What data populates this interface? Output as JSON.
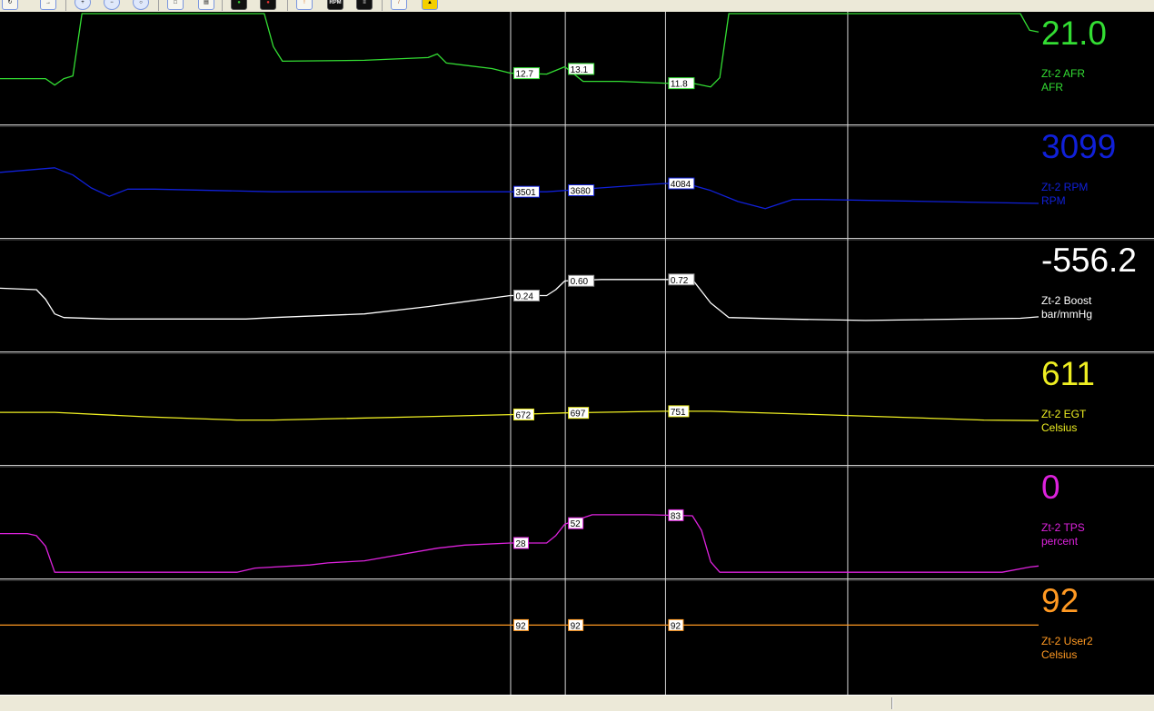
{
  "colors": {
    "background": "#000000",
    "separator": "#c8c8c8",
    "cursor": "#d8d8d8",
    "toolbar": "#ece9d8"
  },
  "toolbar": {
    "buttons": [
      {
        "icon": "refresh-icon"
      },
      {
        "icon": "arrow-icon"
      },
      {
        "icon": "zoom-in-icon"
      },
      {
        "icon": "zoom-out-icon"
      },
      {
        "icon": "zoom-reset-icon"
      },
      {
        "icon": "document-icon"
      },
      {
        "icon": "print-icon"
      },
      {
        "icon": "record-icon"
      },
      {
        "icon": "stop-record-icon"
      },
      {
        "icon": "alert-icon"
      },
      {
        "icon": "rpm-icon",
        "label": "RPM"
      },
      {
        "icon": "gauge-icon"
      },
      {
        "icon": "wrench-icon"
      },
      {
        "icon": "warning-icon"
      }
    ]
  },
  "chart_data": {
    "type": "line",
    "samples": 115,
    "cursors": [
      56,
      62,
      73,
      93
    ],
    "channels": [
      {
        "key": "afr",
        "name": "Zt-2 AFR",
        "unit": "AFR",
        "value": "21.0",
        "color": "#33dd33",
        "ymin": 10,
        "ymax": 16,
        "points": [
          [
            0,
            12.45
          ],
          [
            5,
            12.45
          ],
          [
            6,
            12.1
          ],
          [
            7,
            12.45
          ],
          [
            8,
            12.6
          ],
          [
            9,
            16.5
          ],
          [
            29,
            16.5
          ],
          [
            30,
            14.2
          ],
          [
            31,
            13.4
          ],
          [
            40,
            13.45
          ],
          [
            47,
            13.6
          ],
          [
            48,
            13.8
          ],
          [
            49,
            13.3
          ],
          [
            54,
            13.0
          ],
          [
            56,
            12.75
          ],
          [
            60,
            12.7
          ],
          [
            62,
            13.1
          ],
          [
            64,
            12.3
          ],
          [
            68,
            12.3
          ],
          [
            73,
            12.2
          ],
          [
            76,
            12.2
          ],
          [
            78,
            12.0
          ],
          [
            79,
            12.5
          ],
          [
            80,
            16.5
          ],
          [
            112,
            16.5
          ],
          [
            113,
            15.1
          ],
          [
            114,
            15.0
          ]
        ],
        "labels": [
          {
            "x": 57,
            "text": "12.7"
          },
          {
            "x": 63,
            "text": "13.1"
          },
          {
            "x": 74,
            "text": "11.8"
          }
        ]
      },
      {
        "key": "rpm",
        "name": "Zt-2 RPM",
        "unit": "RPM",
        "value": "3099",
        "color": "#1020d8",
        "ymin": 2800,
        "ymax": 4500,
        "points": [
          [
            0,
            3800
          ],
          [
            6,
            3870
          ],
          [
            8,
            3760
          ],
          [
            10,
            3560
          ],
          [
            12,
            3430
          ],
          [
            14,
            3540
          ],
          [
            17,
            3540
          ],
          [
            30,
            3500
          ],
          [
            60,
            3500
          ],
          [
            66,
            3560
          ],
          [
            72,
            3620
          ],
          [
            75,
            3640
          ],
          [
            78,
            3520
          ],
          [
            81,
            3350
          ],
          [
            84,
            3240
          ],
          [
            87,
            3380
          ],
          [
            90,
            3380
          ],
          [
            114,
            3320
          ]
        ],
        "labels": [
          {
            "x": 57,
            "text": "3501"
          },
          {
            "x": 63,
            "text": "3680"
          },
          {
            "x": 74,
            "text": "4084"
          }
        ]
      },
      {
        "key": "boost",
        "name": "Zt-2 Boost",
        "unit": "bar/mmHg",
        "value": "-556.2",
        "color": "#ffffff",
        "ymin": -0.5,
        "ymax": 1.0,
        "points": [
          [
            0,
            0.35
          ],
          [
            4,
            0.33
          ],
          [
            5,
            0.2
          ],
          [
            6,
            0.0
          ],
          [
            7,
            -0.05
          ],
          [
            12,
            -0.07
          ],
          [
            27,
            -0.07
          ],
          [
            30,
            -0.05
          ],
          [
            40,
            0.0
          ],
          [
            47,
            0.1
          ],
          [
            56,
            0.25
          ],
          [
            60,
            0.25
          ],
          [
            61,
            0.33
          ],
          [
            62,
            0.45
          ],
          [
            66,
            0.47
          ],
          [
            73,
            0.47
          ],
          [
            76,
            0.47
          ],
          [
            78,
            0.15
          ],
          [
            80,
            -0.05
          ],
          [
            86,
            -0.07
          ],
          [
            95,
            -0.09
          ],
          [
            112,
            -0.06
          ],
          [
            114,
            -0.04
          ]
        ],
        "labels": [
          {
            "x": 57,
            "text": "0.24"
          },
          {
            "x": 63,
            "text": "0.60"
          },
          {
            "x": 74,
            "text": "0.72"
          }
        ]
      },
      {
        "key": "egt",
        "name": "Zt-2 EGT",
        "unit": "Celsius",
        "value": "611",
        "color": "#eeee22",
        "ymin": 600,
        "ymax": 800,
        "points": [
          [
            0,
            694
          ],
          [
            6,
            694
          ],
          [
            16,
            686
          ],
          [
            26,
            680
          ],
          [
            30,
            680
          ],
          [
            46,
            686
          ],
          [
            56,
            690
          ],
          [
            62,
            693
          ],
          [
            73,
            696
          ],
          [
            78,
            696
          ],
          [
            90,
            690
          ],
          [
            108,
            680
          ],
          [
            114,
            679
          ]
        ],
        "labels": [
          {
            "x": 57,
            "text": "672"
          },
          {
            "x": 63,
            "text": "697"
          },
          {
            "x": 74,
            "text": "751"
          }
        ]
      },
      {
        "key": "tps",
        "name": "Zt-2 TPS",
        "unit": "percent",
        "value": "0",
        "color": "#dd22dd",
        "ymin": -5,
        "ymax": 100,
        "points": [
          [
            0,
            37
          ],
          [
            3,
            37
          ],
          [
            4,
            35
          ],
          [
            5,
            25
          ],
          [
            6,
            0
          ],
          [
            26,
            0
          ],
          [
            28,
            4
          ],
          [
            34,
            7
          ],
          [
            36,
            9
          ],
          [
            40,
            11
          ],
          [
            48,
            23
          ],
          [
            51,
            26
          ],
          [
            56,
            28
          ],
          [
            60,
            28
          ],
          [
            61,
            35
          ],
          [
            62,
            46
          ],
          [
            64,
            52
          ],
          [
            65,
            55
          ],
          [
            71,
            55
          ],
          [
            76,
            54
          ],
          [
            77,
            40
          ],
          [
            78,
            10
          ],
          [
            79,
            0
          ],
          [
            110,
            0
          ],
          [
            113,
            5
          ],
          [
            114,
            6
          ]
        ],
        "labels": [
          {
            "x": 57,
            "text": "28"
          },
          {
            "x": 63,
            "text": "52"
          },
          {
            "x": 74,
            "text": "83"
          }
        ]
      },
      {
        "key": "user2",
        "name": "Zt-2 User2",
        "unit": "Celsius",
        "value": "92",
        "color": "#ff9922",
        "ymin": 80,
        "ymax": 100,
        "points": [
          [
            0,
            92
          ],
          [
            114,
            92
          ]
        ],
        "labels": [
          {
            "x": 57,
            "text": "92"
          },
          {
            "x": 63,
            "text": "92"
          },
          {
            "x": 74,
            "text": "92"
          }
        ]
      }
    ]
  }
}
